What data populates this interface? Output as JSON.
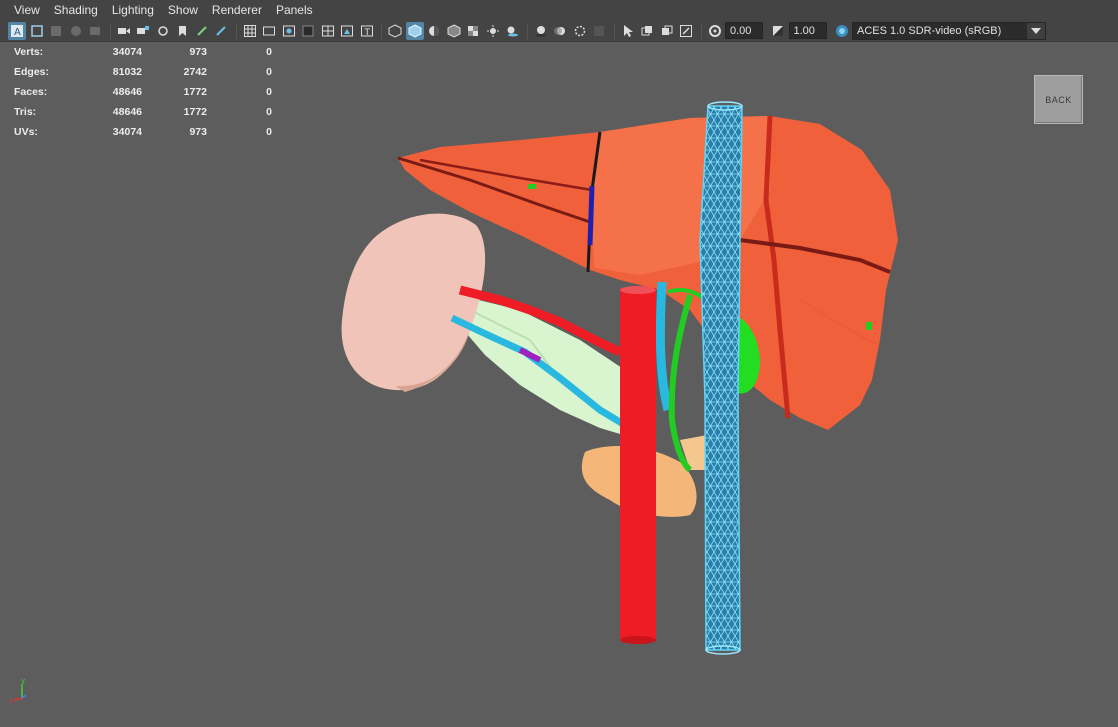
{
  "menu": [
    "View",
    "Shading",
    "Lighting",
    "Show",
    "Renderer",
    "Panels"
  ],
  "toolbar": {
    "exposure": "0.00",
    "gamma": "1.00",
    "color_space": "ACES 1.0 SDR-video (sRGB)"
  },
  "stats": [
    {
      "label": "Verts:",
      "v1": "34074",
      "v2": "973",
      "v3": "0"
    },
    {
      "label": "Edges:",
      "v1": "81032",
      "v2": "2742",
      "v3": "0"
    },
    {
      "label": "Faces:",
      "v1": "48646",
      "v2": "1772",
      "v3": "0"
    },
    {
      "label": "Tris:",
      "v1": "48646",
      "v2": "1772",
      "v3": "0"
    },
    {
      "label": "UVs:",
      "v1": "34074",
      "v2": "973",
      "v3": "0"
    }
  ],
  "back_label": "BACK",
  "axis": {
    "y": "y",
    "x": "x"
  },
  "colors": {
    "viewport_bg": "#5d5d5d",
    "liver": "#f0603a",
    "aorta": "#ee1c24",
    "ivc_wireframe": "#29b8e0",
    "spleen": "#f0c4b8",
    "gallbladder": "#22dd22",
    "pancreas": "#d8f5d0",
    "duodenum": "#f5b67a"
  }
}
